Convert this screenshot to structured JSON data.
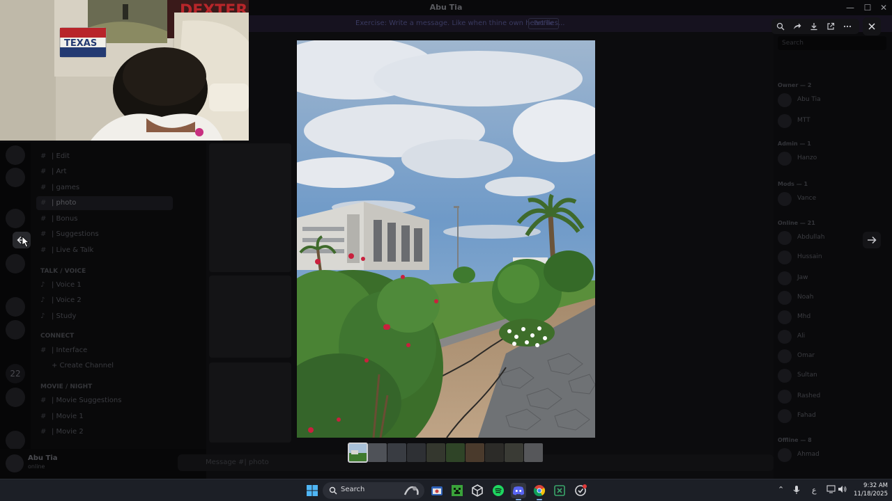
{
  "window": {
    "title": "Abu Tia"
  },
  "notice": {
    "text": "Exercise: Write a message. Like when thine own heart lies...",
    "button": "Profile"
  },
  "channels": {
    "items": [
      "| Edit",
      "| Art",
      "| games",
      "| photo",
      "| Bonus",
      "| Suggestions",
      "| Live & Talk"
    ],
    "voice_category": "TALK / VOICE",
    "voice_items": [
      "| Voice 1",
      "| Voice 2",
      "| Study"
    ],
    "category_2": "CONNECT",
    "items_2": [
      "| Interface",
      "+ Create Channel"
    ],
    "category_3": "MOVIE / NIGHT",
    "items_3": [
      "| Movie Suggestions",
      "| Movie 1",
      "| Movie 2"
    ]
  },
  "user": {
    "name": "Abu Tia",
    "status": "online"
  },
  "chat": {
    "placeholder": "Message #| photo"
  },
  "members": {
    "search_placeholder": "Search",
    "groups": [
      "Owner — 2",
      "Admin — 1",
      "Mods — 1",
      "Online — 21",
      "Offline — 8"
    ],
    "names": [
      "Abu Tia",
      "MTT",
      "Hanzo",
      "Vance",
      "Abdullah",
      "Hussain",
      "Jaw",
      "Noah",
      "Mhd",
      "Ali",
      "Omar",
      "Sultan",
      "Rashed",
      "Fahad",
      "Ahmad"
    ]
  },
  "webcam": {
    "sign_text": "TEXAS",
    "poster_text": "DEXTER"
  },
  "lightbox": {
    "tools": [
      "zoom-icon",
      "forward-icon",
      "download-icon",
      "open-external-icon",
      "more-icon"
    ],
    "thumbnail_count": 10,
    "selected_thumbnail": 1
  },
  "taskbar": {
    "search_label": "Search",
    "apps": [
      "file-explorer-icon",
      "minecraft-icon",
      "unity-icon",
      "spotify-icon",
      "discord-icon",
      "chrome-icon",
      "excel-icon",
      "media-icon"
    ],
    "keyboard": "ع",
    "time": "9:32 AM",
    "date": "11/18/2025"
  }
}
